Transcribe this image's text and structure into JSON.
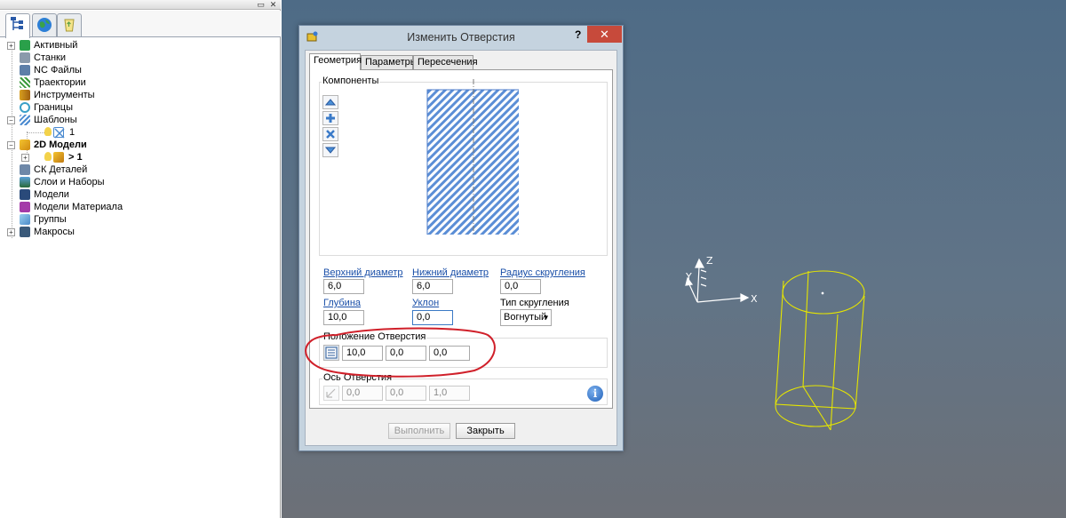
{
  "explorer": {
    "tree": [
      {
        "label": "Активный",
        "bold": false
      },
      {
        "label": "Станки",
        "bold": false
      },
      {
        "label": "NC Файлы",
        "bold": false
      },
      {
        "label": "Траектории",
        "bold": false
      },
      {
        "label": "Инструменты",
        "bold": false
      },
      {
        "label": "Границы",
        "bold": false
      },
      {
        "label": "Шаблоны",
        "bold": false
      },
      {
        "label": "1",
        "bold": false
      },
      {
        "label": "2D Модели",
        "bold": true
      },
      {
        "label": "> 1",
        "bold": true
      },
      {
        "label": "СК Деталей",
        "bold": false
      },
      {
        "label": "Слои и Наборы",
        "bold": false
      },
      {
        "label": "Модели",
        "bold": false
      },
      {
        "label": "Модели Материала",
        "bold": false
      },
      {
        "label": "Группы",
        "bold": false
      },
      {
        "label": "Макросы",
        "bold": false
      }
    ],
    "tabs": [
      "tree-tab-icon",
      "globe-tab-icon",
      "recycle-tab-icon"
    ]
  },
  "dialog": {
    "title": "Изменить Отверстия",
    "help": "?",
    "close": "✕",
    "tabs": [
      "Геометрия",
      "Параметры",
      "Пересечения"
    ],
    "components_label": "Компоненты",
    "fields": {
      "top_diameter": {
        "label": "Верхний диаметр",
        "value": "6,0"
      },
      "bottom_diameter": {
        "label": "Нижний диаметр",
        "value": "6,0"
      },
      "fillet_radius": {
        "label": "Радиус скругления",
        "value": "0,0"
      },
      "depth": {
        "label": "Глубина",
        "value": "10,0"
      },
      "taper": {
        "label": "Уклон",
        "value": "0,0"
      },
      "fillet_type_label": "Тип скругления",
      "fillet_type_value": "Вогнутый"
    },
    "position": {
      "label": "Положение Отверстия",
      "x": "10,0",
      "y": "0,0",
      "z": "0,0"
    },
    "axis": {
      "label": "Ось Отверстия",
      "x": "0,0",
      "y": "0,0",
      "z": "1,0"
    },
    "buttons": {
      "apply": "Выполнить",
      "close": "Закрыть"
    },
    "info": "i"
  },
  "viewport": {
    "axes": {
      "x": "X",
      "y": "Y",
      "z": "Z"
    },
    "colors": {
      "background_top": "#4e6b86",
      "background_bottom": "#6c7077",
      "wireframe": "#e6e600",
      "annotation": "#d0202a"
    }
  }
}
